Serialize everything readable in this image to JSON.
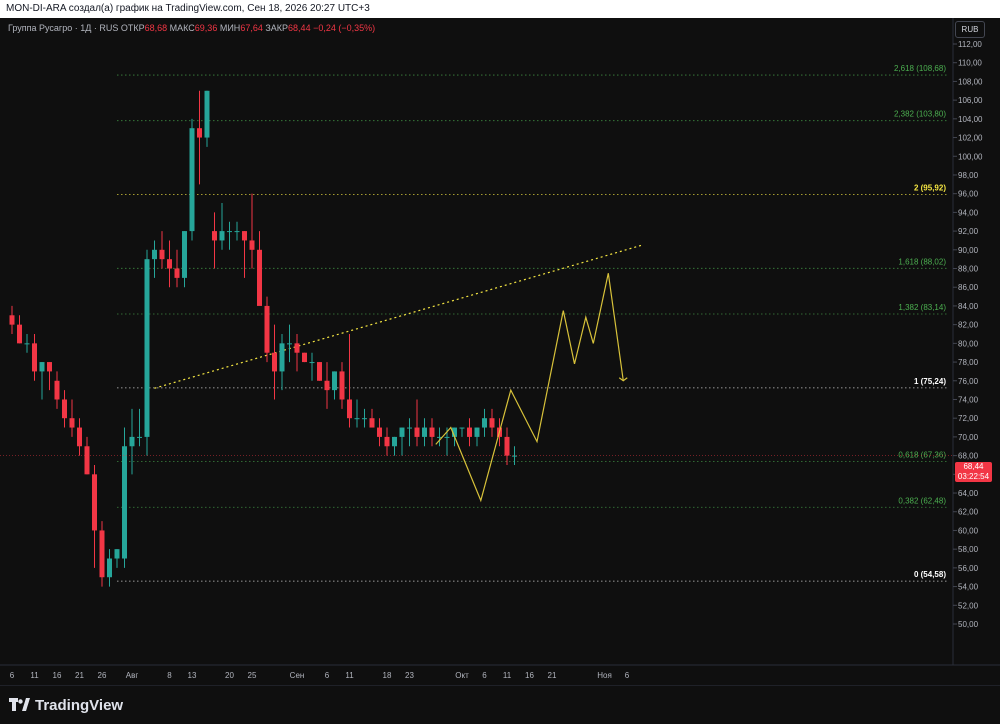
{
  "header": {
    "text": "MON-DI-ARA создал(а) график на TradingView.com, Сен 18, 2026 20:27 UTC+3"
  },
  "legend": {
    "symbol": "Группа Русагро · 1Д · RUS",
    "open_label": "ОТКР",
    "open": "68,68",
    "high_label": "МАКС",
    "high": "69,36",
    "low_label": "МИН",
    "low": "67,64",
    "close_label": "ЗАКР",
    "close": "68,44",
    "change": "−0,24 (−0,35%)"
  },
  "currency": "RUB",
  "price_badge": {
    "price": "68,44",
    "countdown": "03:22:54"
  },
  "brand": {
    "name": "TradingView"
  },
  "colors": {
    "up": "#26a69a",
    "down": "#f23645",
    "fib_green": "#4caf50",
    "fib_yellow": "#f5e642",
    "fib_white": "#ffffff",
    "projection": "#d8c23a"
  },
  "chart_data": {
    "type": "candlestick",
    "y_axis": {
      "min": 47,
      "max": 112,
      "tick_values": [
        50,
        52,
        54,
        56,
        58,
        60,
        62,
        64,
        66,
        68,
        70,
        72,
        74,
        76,
        78,
        80,
        82,
        84,
        86,
        88,
        90,
        92,
        94,
        96,
        98,
        100,
        102,
        104,
        106,
        108,
        110,
        112
      ],
      "tick_labels": [
        "50,00",
        "52,00",
        "54,00",
        "56,00",
        "58,00",
        "60,00",
        "62,00",
        "64,00",
        "66,00",
        "68,00",
        "70,00",
        "72,00",
        "74,00",
        "76,00",
        "78,00",
        "80,00",
        "82,00",
        "84,00",
        "86,00",
        "88,00",
        "90,00",
        "92,00",
        "94,00",
        "96,00",
        "98,00",
        "100,00",
        "102,00",
        "104,00",
        "106,00",
        "108,00",
        "110,00",
        "112,00"
      ]
    },
    "x_axis": {
      "labels": [
        {
          "text": "6",
          "bar": 0
        },
        {
          "text": "11",
          "bar": 3
        },
        {
          "text": "16",
          "bar": 6
        },
        {
          "text": "21",
          "bar": 9
        },
        {
          "text": "26",
          "bar": 12
        },
        {
          "text": "Авг",
          "bar": 16
        },
        {
          "text": "8",
          "bar": 21
        },
        {
          "text": "13",
          "bar": 24
        },
        {
          "text": "20",
          "bar": 29
        },
        {
          "text": "25",
          "bar": 32
        },
        {
          "text": "Сен",
          "bar": 38
        },
        {
          "text": "6",
          "bar": 42
        },
        {
          "text": "11",
          "bar": 45
        },
        {
          "text": "18",
          "bar": 50
        },
        {
          "text": "23",
          "bar": 53
        },
        {
          "text": "Окт",
          "bar": 60
        },
        {
          "text": "6",
          "bar": 63
        },
        {
          "text": "11",
          "bar": 66
        },
        {
          "text": "16",
          "bar": 69
        },
        {
          "text": "21",
          "bar": 72
        },
        {
          "text": "Ноя",
          "bar": 79
        },
        {
          "text": "6",
          "bar": 82
        }
      ]
    },
    "candles": [
      [
        83,
        84,
        81,
        82
      ],
      [
        82,
        83,
        80,
        80
      ],
      [
        80,
        81,
        79,
        80
      ],
      [
        80,
        81,
        76,
        77
      ],
      [
        77,
        78,
        74,
        78
      ],
      [
        78,
        78,
        75,
        77
      ],
      [
        76,
        77,
        73,
        74
      ],
      [
        74,
        75,
        71,
        72
      ],
      [
        72,
        74,
        70,
        71
      ],
      [
        71,
        72,
        68,
        69
      ],
      [
        69,
        70,
        66,
        66
      ],
      [
        66,
        67,
        56,
        60
      ],
      [
        60,
        61,
        54,
        55
      ],
      [
        55,
        58,
        54,
        57
      ],
      [
        57,
        58,
        56,
        58
      ],
      [
        57,
        71,
        56,
        69
      ],
      [
        69,
        73,
        66,
        70
      ],
      [
        70,
        73,
        69,
        70
      ],
      [
        70,
        90,
        68,
        89
      ],
      [
        89,
        91,
        87,
        90
      ],
      [
        90,
        92,
        88,
        89
      ],
      [
        89,
        91,
        86,
        88
      ],
      [
        88,
        90,
        86,
        87
      ],
      [
        87,
        92,
        86,
        92
      ],
      [
        92,
        104,
        91,
        103
      ],
      [
        103,
        107,
        97,
        102
      ],
      [
        102,
        107,
        101,
        107
      ],
      [
        92,
        94,
        88,
        91
      ],
      [
        91,
        95,
        90,
        92
      ],
      [
        92,
        93,
        90,
        92
      ],
      [
        92,
        93,
        91,
        92
      ],
      [
        92,
        92,
        87,
        91
      ],
      [
        91,
        96,
        88,
        90
      ],
      [
        90,
        92,
        85,
        84
      ],
      [
        84,
        85,
        78,
        79
      ],
      [
        79,
        82,
        74,
        77
      ],
      [
        77,
        81,
        75,
        80
      ],
      [
        80,
        82,
        78,
        80
      ],
      [
        80,
        81,
        77,
        79
      ],
      [
        79,
        79,
        78,
        78
      ],
      [
        78,
        79,
        76,
        78
      ],
      [
        78,
        78,
        76,
        76
      ],
      [
        76,
        78,
        73,
        75
      ],
      [
        75,
        77,
        74,
        77
      ],
      [
        77,
        78,
        73,
        74
      ],
      [
        74,
        81,
        71,
        72
      ],
      [
        72,
        74,
        71,
        72
      ],
      [
        72,
        73,
        71,
        72
      ],
      [
        72,
        73,
        71,
        71
      ],
      [
        71,
        72,
        69,
        70
      ],
      [
        70,
        71,
        68,
        69
      ],
      [
        69,
        70,
        68,
        70
      ],
      [
        70,
        71,
        68,
        71
      ],
      [
        71,
        72,
        69,
        71
      ],
      [
        71,
        74,
        69,
        70
      ],
      [
        70,
        72,
        69,
        71
      ],
      [
        71,
        72,
        69,
        70
      ],
      [
        70,
        71,
        69,
        70
      ],
      [
        70,
        71,
        68,
        70
      ],
      [
        70,
        71,
        69,
        71
      ],
      [
        71,
        71,
        70,
        71
      ],
      [
        71,
        72,
        69,
        70
      ],
      [
        70,
        71,
        69,
        71
      ],
      [
        71,
        73,
        70,
        72
      ],
      [
        72,
        73,
        70,
        71
      ],
      [
        71,
        72,
        69,
        70
      ],
      [
        70,
        71,
        67,
        68
      ],
      [
        68,
        69,
        67,
        68
      ]
    ],
    "fib_levels": [
      {
        "label": "2,618 (108,68)",
        "value": 108.68,
        "color": "fib_green"
      },
      {
        "label": "2,382 (103,80)",
        "value": 103.8,
        "color": "fib_green"
      },
      {
        "label": "2 (95,92)",
        "value": 95.92,
        "color": "fib_yellow"
      },
      {
        "label": "1,618 (88,02)",
        "value": 88.02,
        "color": "fib_green"
      },
      {
        "label": "1,382 (83,14)",
        "value": 83.14,
        "color": "fib_green"
      },
      {
        "label": "1 (75,24)",
        "value": 75.24,
        "color": "fib_white"
      },
      {
        "label": "0,618 (67,36)",
        "value": 67.36,
        "color": "fib_green"
      },
      {
        "label": "0,382 (62,48)",
        "value": 62.48,
        "color": "fib_green"
      },
      {
        "label": "0 (54,58)",
        "value": 54.58,
        "color": "fib_white"
      }
    ],
    "trend_line": {
      "from": {
        "bar": 19,
        "value": 75.2
      },
      "to": {
        "bar": 84,
        "value": 90.5
      }
    },
    "projection": [
      {
        "bar": 56.5,
        "value": 69.2
      },
      {
        "bar": 58.5,
        "value": 71.0
      },
      {
        "bar": 62.5,
        "value": 63.2
      },
      {
        "bar": 66.5,
        "value": 75.0
      },
      {
        "bar": 70,
        "value": 69.5
      },
      {
        "bar": 73.5,
        "value": 83.5
      },
      {
        "bar": 75,
        "value": 77.8
      },
      {
        "bar": 76.5,
        "value": 82.8
      },
      {
        "bar": 77.5,
        "value": 80.0
      },
      {
        "bar": 79.5,
        "value": 87.5
      },
      {
        "bar": 81.5,
        "value": 76.0
      }
    ]
  }
}
